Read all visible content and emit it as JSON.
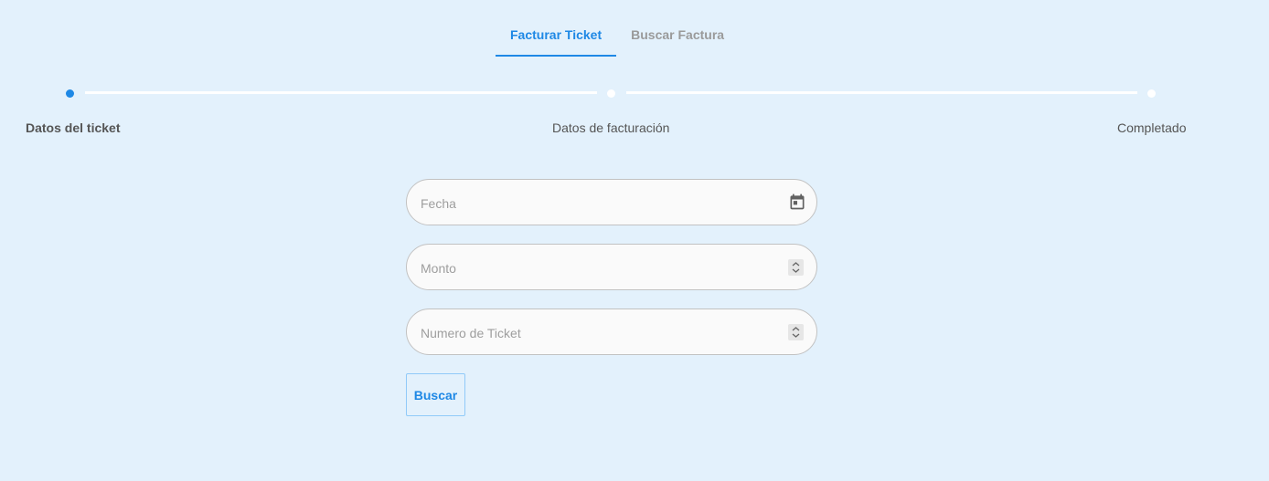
{
  "tabs": [
    {
      "label": "Facturar Ticket",
      "active": true
    },
    {
      "label": "Buscar Factura",
      "active": false
    }
  ],
  "stepper": {
    "steps": [
      {
        "label": "Datos del ticket",
        "active": true
      },
      {
        "label": "Datos de facturación",
        "active": false
      },
      {
        "label": "Completado",
        "active": false
      }
    ]
  },
  "form": {
    "fecha_placeholder": "Fecha",
    "monto_placeholder": "Monto",
    "ticket_placeholder": "Numero de Ticket",
    "submit_label": "Buscar"
  },
  "icons": {
    "date": "calendar-icon",
    "number": "spinner-icon"
  },
  "colors": {
    "accent": "#1e88e5",
    "background": "#e3f1fc"
  }
}
